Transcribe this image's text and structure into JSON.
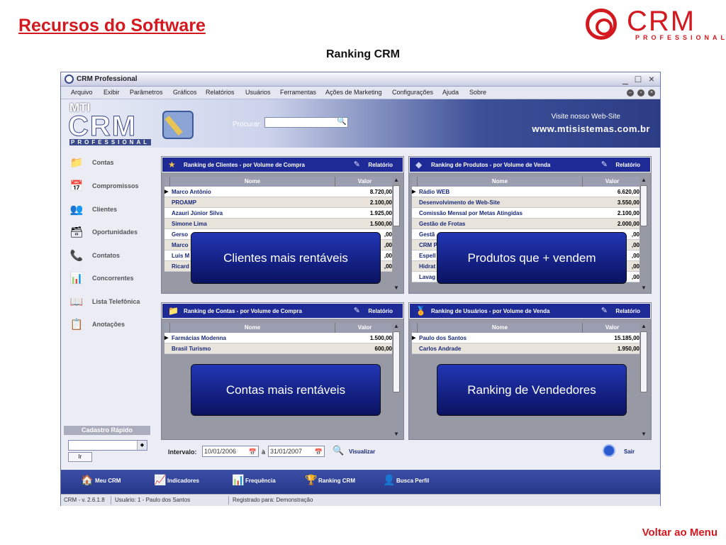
{
  "slide": {
    "title": "Recursos do Software",
    "subtitle": "Ranking CRM",
    "back_link": "Voltar ao Menu",
    "logo_text": "CRM",
    "logo_sub": "PROFESSIONAL"
  },
  "window": {
    "title": "CRM Professional",
    "controls": [
      "_",
      "□",
      "×"
    ],
    "menu": [
      "Arquivo",
      "Exibir",
      "Parâmetros",
      "Gráficos",
      "Relatórios",
      "Usuários",
      "Ferramentas",
      "Ações de Marketing",
      "Configurações",
      "Ajuda",
      "Sobre"
    ]
  },
  "banner": {
    "mti": "MTI",
    "crm": "CRM",
    "professional": "PROFESSIONAL",
    "search_label": "Procurar:",
    "search_value": "",
    "visit_text": "Visite nosso Web-Site",
    "url": "www.mtisistemas.com.br"
  },
  "sidebar": {
    "items": [
      {
        "label": "Contas",
        "icon": "folder-icon"
      },
      {
        "label": "Compromissos",
        "icon": "calendar-icon"
      },
      {
        "label": "Clientes",
        "icon": "users-icon"
      },
      {
        "label": "Oportunidades",
        "icon": "opportunity-icon"
      },
      {
        "label": "Contatos",
        "icon": "phone-icon"
      },
      {
        "label": "Concorrentes",
        "icon": "competitor-icon"
      },
      {
        "label": "Lista Telefônica",
        "icon": "phonebook-icon"
      },
      {
        "label": "Anotações",
        "icon": "notes-icon"
      }
    ],
    "quick_title": "Cadastro Rápido",
    "quick_button": "Ir"
  },
  "panels": {
    "clientes": {
      "title": "Ranking de Clientes - por Volume de Compra",
      "report": "Relatório",
      "col_name": "Nome",
      "col_value": "Valor",
      "rows": [
        {
          "name": "Marco Antônio",
          "value": "8.720,00"
        },
        {
          "name": "PROAMP",
          "value": "2.100,00"
        },
        {
          "name": "Azauri Júnior Silva",
          "value": "1.925,00"
        },
        {
          "name": "Simone Lima",
          "value": "1.500,00"
        },
        {
          "name": "Gerso",
          "value": ",00"
        },
        {
          "name": "Marco",
          "value": ",00"
        },
        {
          "name": "Luis M",
          "value": ",00"
        },
        {
          "name": "Ricard",
          "value": ",00"
        }
      ]
    },
    "produtos": {
      "title": "Ranking de Produtos - por Volume de Venda",
      "report": "Relatório",
      "col_name": "Nome",
      "col_value": "Valor",
      "rows": [
        {
          "name": "Rádio WEB",
          "value": "6.620,00"
        },
        {
          "name": "Desenvolvimento de Web-Site",
          "value": "3.550,00"
        },
        {
          "name": "Comissão Mensal por Metas Atingidas",
          "value": "2.100,00"
        },
        {
          "name": "Gestão de Frotas",
          "value": "2.000,00"
        },
        {
          "name": "Gestã",
          "value": ",00"
        },
        {
          "name": "CRM P",
          "value": ",00"
        },
        {
          "name": "Espell",
          "value": ",00"
        },
        {
          "name": "Hidrat",
          "value": ",00"
        },
        {
          "name": "Lavag",
          "value": ",00"
        }
      ]
    },
    "contas": {
      "title": "Ranking de Contas - por Volume de Compra",
      "report": "Relatório",
      "col_name": "Nome",
      "col_value": "Valor",
      "rows": [
        {
          "name": "Farmácias Modenna",
          "value": "1.500,00"
        },
        {
          "name": "Brasil Turismo",
          "value": "600,00"
        }
      ]
    },
    "usuarios": {
      "title": "Ranking de Usuários - por Volume de Venda",
      "report": "Relatório",
      "col_name": "Nome",
      "col_value": "Valor",
      "rows": [
        {
          "name": "Paulo dos Santos",
          "value": "15.185,00"
        },
        {
          "name": "Carlos Andrade",
          "value": "1.950,00"
        }
      ]
    }
  },
  "callouts": {
    "clientes": "Clientes mais rentáveis",
    "produtos": "Produtos que + vendem",
    "contas": "Contas mais rentáveis",
    "usuarios": "Ranking de Vendedores"
  },
  "interval": {
    "label": "Intervalo:",
    "from": "10/01/2006",
    "to_label": "à",
    "to": "31/01/2007",
    "view_label": "Visualizar",
    "exit_label": "Sair"
  },
  "taskbar": [
    "Meu CRM",
    "Indicadores",
    "Frequência",
    "Ranking CRM",
    "Busca Perfil"
  ],
  "status": {
    "version": "CRM - v. 2.6.1.8",
    "user": "Usuário: 1 - Paulo dos Santos",
    "registered": "Registrado para: Demonstração"
  }
}
